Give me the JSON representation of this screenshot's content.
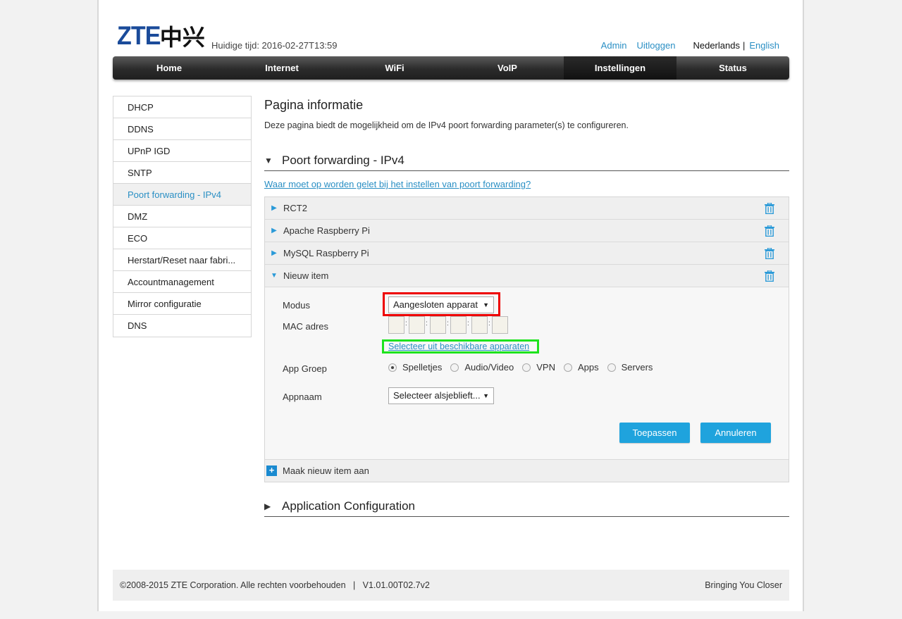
{
  "header": {
    "logo_text": "ZTE",
    "logo_cn": "中兴",
    "time_label": "Huidige tijd: 2016-02-27T13:59",
    "links": {
      "admin": "Admin",
      "logout": "Uitloggen",
      "lang_nl": "Nederlands",
      "lang_sep": "|",
      "lang_en": "English"
    }
  },
  "nav": [
    "Home",
    "Internet",
    "WiFi",
    "VoIP",
    "Instellingen",
    "Status"
  ],
  "nav_active": "Instellingen",
  "sidebar": [
    "DHCP",
    "DDNS",
    "UPnP IGD",
    "SNTP",
    "Poort forwarding - IPv4",
    "DMZ",
    "ECO",
    "Herstart/Reset naar fabri...",
    "Accountmanagement",
    "Mirror configuratie",
    "DNS"
  ],
  "sidebar_active": "Poort forwarding - IPv4",
  "main": {
    "title": "Pagina informatie",
    "description": "Deze pagina biedt de mogelijkheid om de IPv4 poort forwarding parameter(s) te configureren.",
    "section1": "Poort forwarding - IPv4",
    "help_link": "Waar moet op worden gelet bij het instellen van poort forwarding?",
    "items": [
      "RCT2",
      "Apache Raspberry Pi",
      "MySQL Raspberry Pi",
      "Nieuw item"
    ],
    "form": {
      "modus_label": "Modus",
      "modus_value": "Aangesloten apparat",
      "mac_label": "MAC adres",
      "mac_sep": ":",
      "select_link": "Selecteer uit beschikbare apparaten",
      "app_group_label": "App Groep",
      "app_group_options": [
        "Spelletjes",
        "Audio/Video",
        "VPN",
        "Apps",
        "Servers"
      ],
      "app_group_selected": "Spelletjes",
      "appname_label": "Appnaam",
      "appname_value": "Selecteer alsjeblieft...",
      "apply": "Toepassen",
      "cancel": "Annuleren"
    },
    "add_item": "Maak nieuw item aan",
    "section2": "Application Configuration"
  },
  "footer": {
    "copyright": "©2008-2015 ZTE Corporation. Alle rechten voorbehouden   |   V1.01.00T02.7v2",
    "slogan": "Bringing You Closer"
  },
  "colors": {
    "accent": "#2a8fc4",
    "button": "#1fa3dd",
    "annot_red": "#ee0000",
    "annot_green": "#1ee31e"
  }
}
